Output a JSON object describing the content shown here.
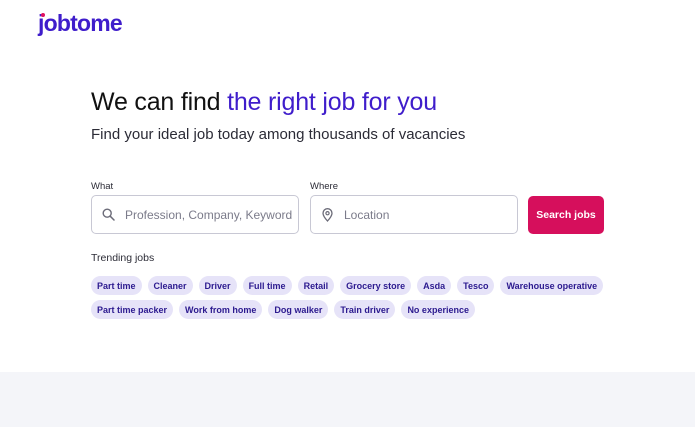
{
  "brand": {
    "logo_text": "jobtome",
    "accent": "#3f1dcb",
    "cta": "#d60f5c"
  },
  "hero": {
    "title_plain": "We can find ",
    "title_accent": "the right job for you",
    "subtitle": "Find your ideal job today among thousands of vacancies"
  },
  "search": {
    "what_label": "What",
    "what_placeholder": "Profession, Company, Keyword",
    "what_icon": "search-icon",
    "where_label": "Where",
    "where_placeholder": "Location",
    "where_icon": "location-pin-icon",
    "button_label": "Search jobs"
  },
  "trending": {
    "title": "Trending jobs",
    "row1": [
      "Part time",
      "Cleaner",
      "Driver",
      "Full time",
      "Retail",
      "Grocery store",
      "Asda",
      "Tesco",
      "Warehouse operative"
    ],
    "row2": [
      "Part time packer",
      "Work from home",
      "Dog walker",
      "Train driver",
      "No experience"
    ]
  }
}
